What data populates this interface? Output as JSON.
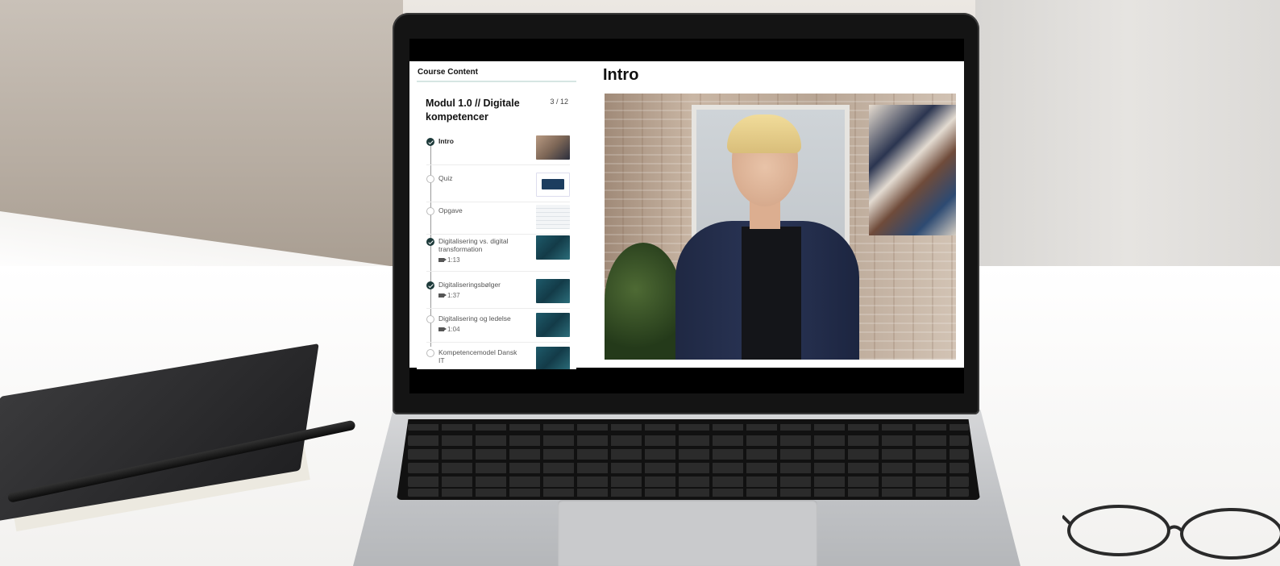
{
  "app": {
    "course_content_label": "Course Content",
    "module": {
      "title": "Modul 1.0 // Digitale kompetencer",
      "progress": "3 / 12"
    },
    "items": [
      {
        "label": "Intro",
        "duration": "",
        "completed": true,
        "active": true,
        "thumb": "video"
      },
      {
        "label": "Quiz",
        "duration": "",
        "completed": false,
        "active": false,
        "thumb": "quiz"
      },
      {
        "label": "Opgave",
        "duration": "",
        "completed": false,
        "active": false,
        "thumb": "task"
      },
      {
        "label": "Digitalisering vs. digital transformation",
        "duration": "1:13",
        "completed": true,
        "active": false,
        "thumb": "teal"
      },
      {
        "label": "Digitaliseringsbølger",
        "duration": "1:37",
        "completed": true,
        "active": false,
        "thumb": "teal"
      },
      {
        "label": "Digitalisering og ledelse",
        "duration": "1:04",
        "completed": false,
        "active": false,
        "thumb": "teal"
      },
      {
        "label": "Kompetencemodel Dansk IT",
        "duration": "",
        "completed": false,
        "active": false,
        "thumb": "teal"
      }
    ],
    "main_title": "Intro",
    "video": {
      "description_icon": "video-player"
    }
  },
  "colors": {
    "check_done": "#1d3a3a",
    "sidebar_border": "#d6e6e3"
  }
}
